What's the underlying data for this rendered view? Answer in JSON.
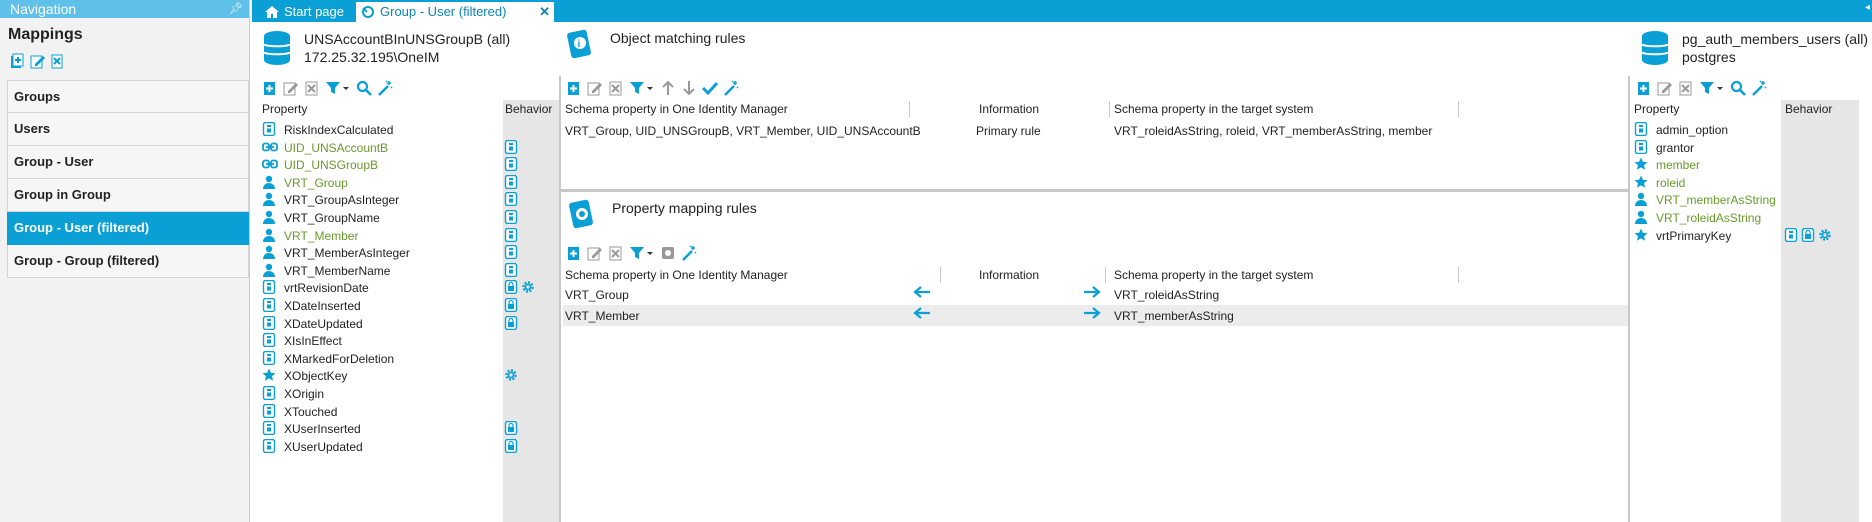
{
  "navigation": {
    "header": "Navigation",
    "title": "Mappings",
    "items": [
      {
        "label": "Groups",
        "active": false
      },
      {
        "label": "Users",
        "active": false
      },
      {
        "label": "Group - User",
        "active": false
      },
      {
        "label": "Group in Group",
        "active": false
      },
      {
        "label": "Group - User (filtered)",
        "active": true
      },
      {
        "label": "Group - Group (filtered)",
        "active": false
      }
    ]
  },
  "tabs": {
    "start": "Start page",
    "current": "Group - User (filtered)"
  },
  "left_object": {
    "line1": "UNSAccountBInUNSGroupB (all)",
    "line2": "172.25.32.195\\OneIM"
  },
  "right_object": {
    "line1": "pg_auth_members_users (all)",
    "line2": "postgres"
  },
  "left_grid": {
    "col_property": "Property",
    "col_behavior": "Behavior",
    "rows": [
      {
        "name": "RiskIndexCalculated",
        "icon": "column",
        "green": false,
        "behavior": []
      },
      {
        "name": "UID_UNSAccountB",
        "icon": "key-link",
        "green": true,
        "behavior": [
          "column"
        ]
      },
      {
        "name": "UID_UNSGroupB",
        "icon": "key-link",
        "green": true,
        "behavior": [
          "column"
        ]
      },
      {
        "name": "VRT_Group",
        "icon": "person",
        "green": true,
        "behavior": [
          "column"
        ]
      },
      {
        "name": "VRT_GroupAsInteger",
        "icon": "person",
        "green": false,
        "behavior": [
          "column"
        ]
      },
      {
        "name": "VRT_GroupName",
        "icon": "person",
        "green": false,
        "behavior": [
          "column"
        ]
      },
      {
        "name": "VRT_Member",
        "icon": "person",
        "green": true,
        "behavior": [
          "column"
        ]
      },
      {
        "name": "VRT_MemberAsInteger",
        "icon": "person",
        "green": false,
        "behavior": [
          "column"
        ]
      },
      {
        "name": "VRT_MemberName",
        "icon": "person",
        "green": false,
        "behavior": [
          "column"
        ]
      },
      {
        "name": "vrtRevisionDate",
        "icon": "column",
        "green": false,
        "behavior": [
          "lock",
          "gear"
        ]
      },
      {
        "name": "XDateInserted",
        "icon": "column",
        "green": false,
        "behavior": [
          "lock"
        ]
      },
      {
        "name": "XDateUpdated",
        "icon": "column",
        "green": false,
        "behavior": [
          "lock"
        ]
      },
      {
        "name": "XIsInEffect",
        "icon": "column",
        "green": false,
        "behavior": []
      },
      {
        "name": "XMarkedForDeletion",
        "icon": "column",
        "green": false,
        "behavior": []
      },
      {
        "name": "XObjectKey",
        "icon": "star",
        "green": false,
        "behavior": [
          "gear"
        ]
      },
      {
        "name": "XOrigin",
        "icon": "column",
        "green": false,
        "behavior": []
      },
      {
        "name": "XTouched",
        "icon": "column",
        "green": false,
        "behavior": []
      },
      {
        "name": "XUserInserted",
        "icon": "column",
        "green": false,
        "behavior": [
          "lock"
        ]
      },
      {
        "name": "XUserUpdated",
        "icon": "column",
        "green": false,
        "behavior": [
          "lock"
        ]
      }
    ]
  },
  "right_grid": {
    "col_property": "Property",
    "col_behavior": "Behavior",
    "rows": [
      {
        "name": "admin_option",
        "icon": "column",
        "green": false,
        "behavior": []
      },
      {
        "name": "grantor",
        "icon": "column",
        "green": false,
        "behavior": []
      },
      {
        "name": "member",
        "icon": "star",
        "green": true,
        "behavior": []
      },
      {
        "name": "roleid",
        "icon": "star",
        "green": true,
        "behavior": []
      },
      {
        "name": "VRT_memberAsString",
        "icon": "person",
        "green": true,
        "behavior": []
      },
      {
        "name": "VRT_roleidAsString",
        "icon": "person",
        "green": true,
        "behavior": []
      },
      {
        "name": "vrtPrimaryKey",
        "icon": "star",
        "green": false,
        "behavior": [
          "column",
          "lock",
          "gear"
        ]
      }
    ]
  },
  "object_matching": {
    "title": "Object matching rules",
    "col_left": "Schema property in One Identity Manager",
    "col_info": "Information",
    "col_right": "Schema property in the target system",
    "rows": [
      {
        "left": "VRT_Group, UID_UNSGroupB, VRT_Member, UID_UNSAccountB",
        "info": "Primary rule",
        "right": "VRT_roleidAsString, roleid, VRT_memberAsString, member"
      }
    ]
  },
  "property_mapping": {
    "title": "Property mapping rules",
    "col_left": "Schema property in One Identity Manager",
    "col_info": "Information",
    "col_right": "Schema property in the target system",
    "rows": [
      {
        "left": "VRT_Group",
        "right": "VRT_roleidAsString",
        "selected": false
      },
      {
        "left": "VRT_Member",
        "right": "VRT_memberAsString",
        "selected": true
      }
    ]
  },
  "colors": {
    "accent": "#0aa0d6",
    "nav_header": "#5fc0ea",
    "green_text": "#6a9a2c"
  }
}
